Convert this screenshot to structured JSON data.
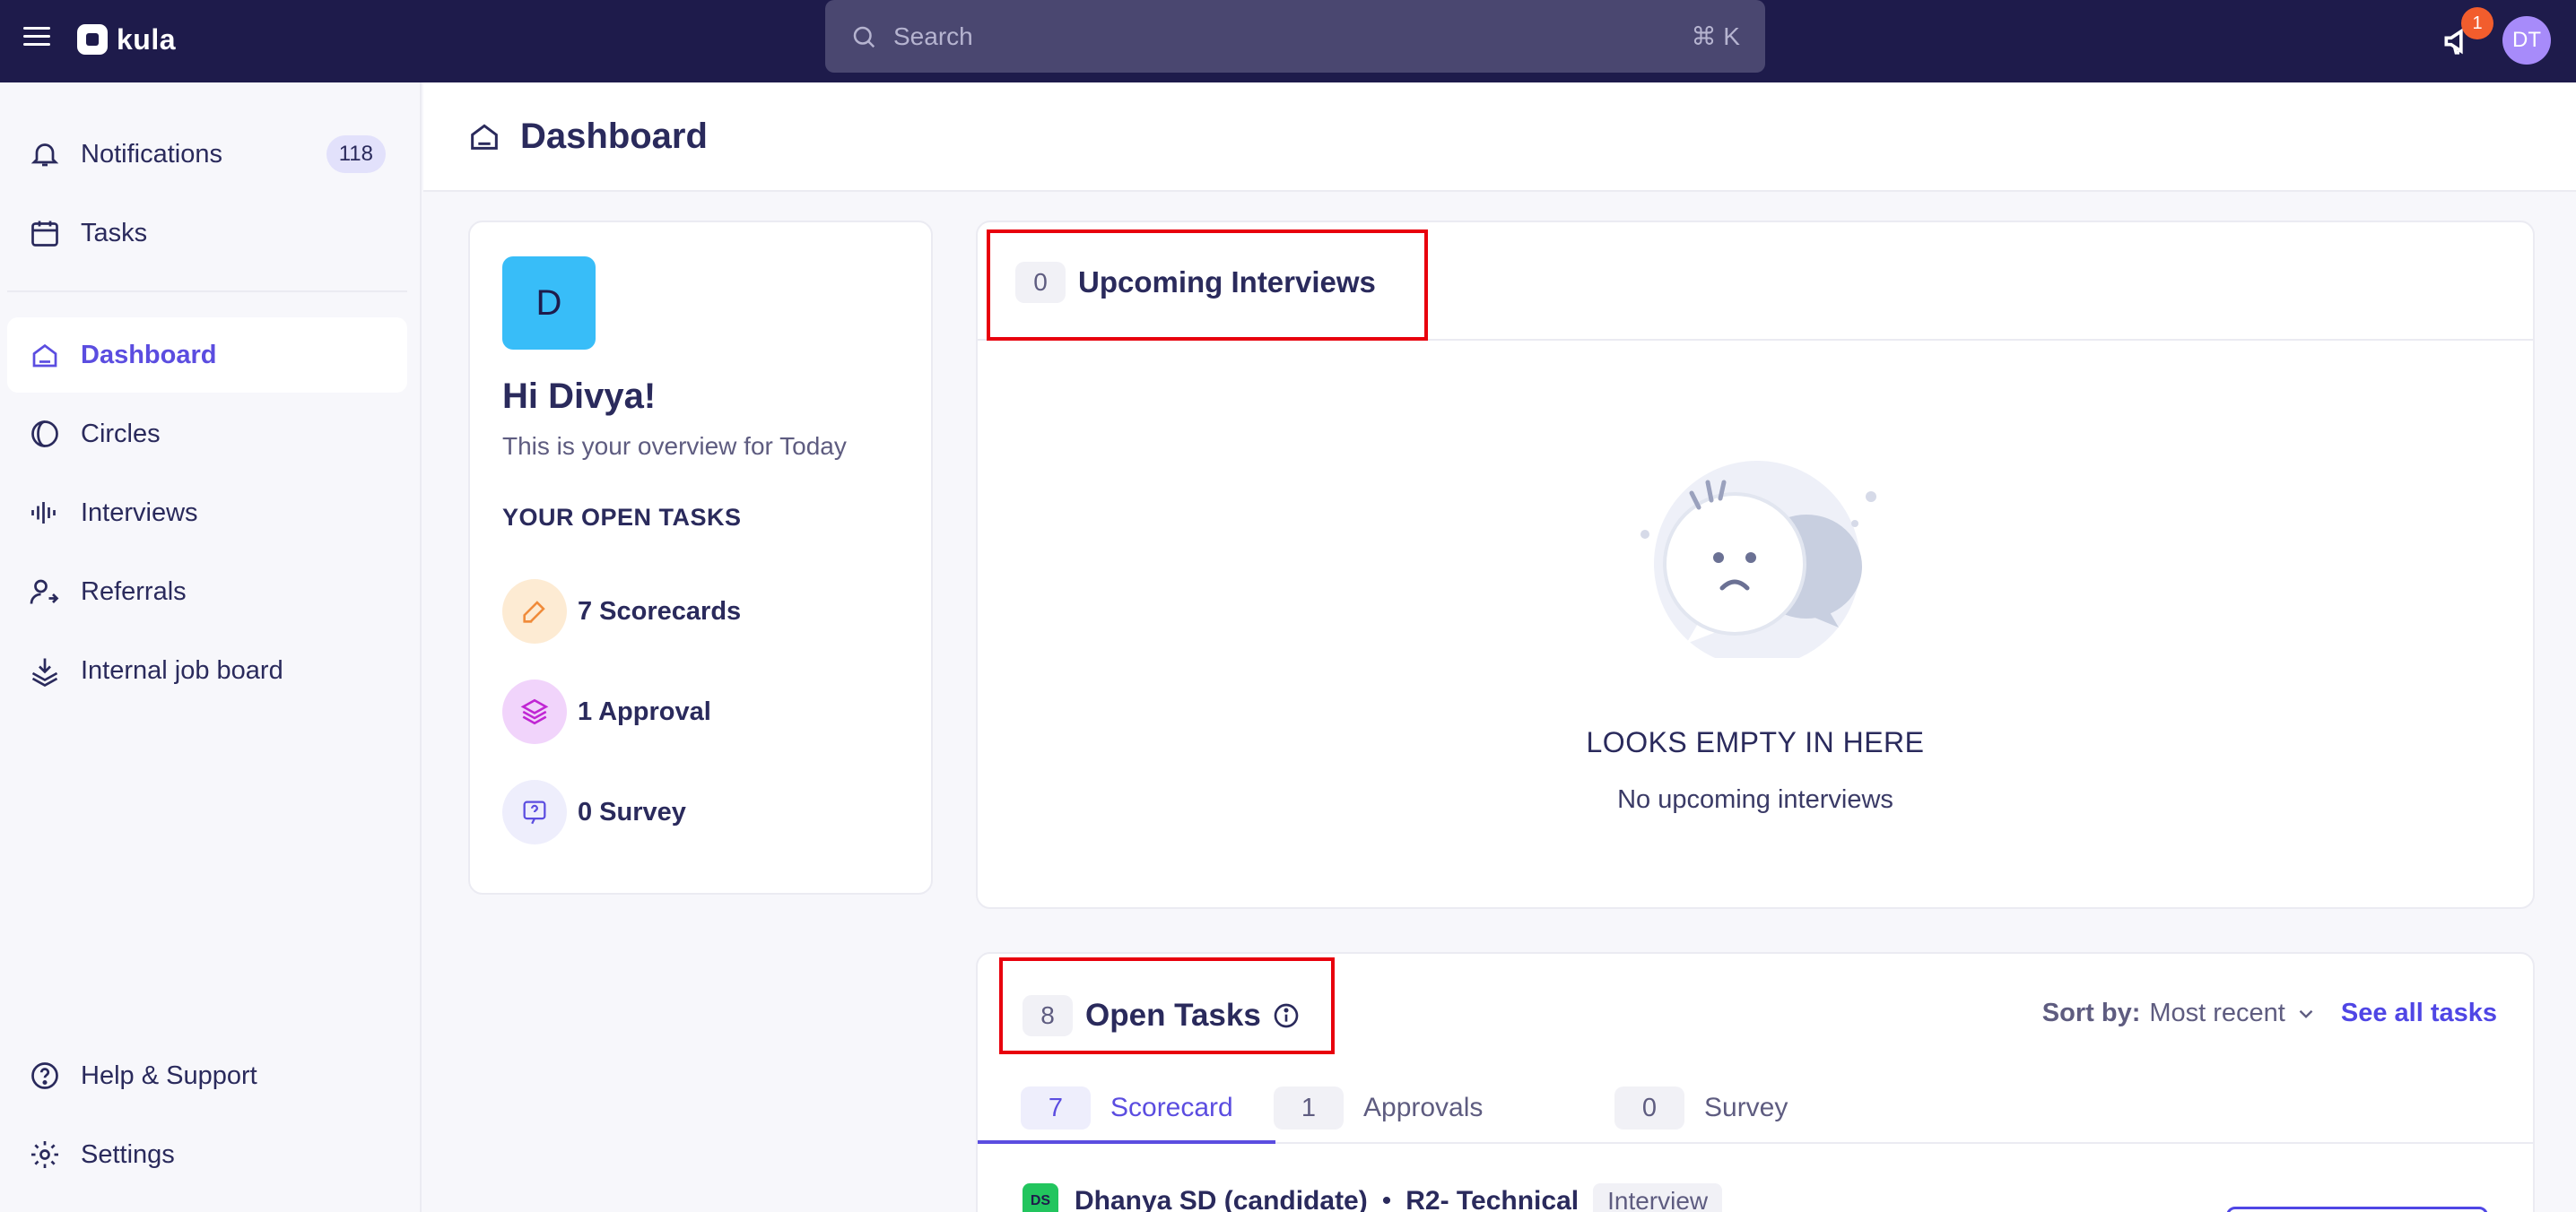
{
  "app": {
    "name": "kula"
  },
  "search": {
    "placeholder": "Search",
    "shortcut": "⌘ K"
  },
  "topbar": {
    "announcement_count": "1",
    "user_initials": "DT"
  },
  "sidebar": {
    "items": [
      {
        "label": "Notifications",
        "icon": "bell-icon",
        "badge": "118"
      },
      {
        "label": "Tasks",
        "icon": "calendar-icon"
      },
      {
        "label": "Dashboard",
        "icon": "home-icon",
        "active": true
      },
      {
        "label": "Circles",
        "icon": "circles-icon"
      },
      {
        "label": "Interviews",
        "icon": "audio-wave-icon"
      },
      {
        "label": "Referrals",
        "icon": "user-arrow-icon"
      },
      {
        "label": "Internal job board",
        "icon": "stack-icon"
      }
    ],
    "footer": [
      {
        "label": "Help & Support",
        "icon": "help-icon"
      },
      {
        "label": "Settings",
        "icon": "gear-icon"
      }
    ]
  },
  "page": {
    "title": "Dashboard"
  },
  "welcome": {
    "avatar_letter": "D",
    "greeting": "Hi Divya!",
    "subtitle": "This is your overview for Today",
    "open_tasks_title": "YOUR OPEN TASKS",
    "tasks": [
      {
        "label": "7 Scorecards",
        "icon": "pencil-icon"
      },
      {
        "label": "1 Approval",
        "icon": "layers-icon"
      },
      {
        "label": "0 Survey",
        "icon": "survey-icon"
      }
    ]
  },
  "interviews": {
    "count": "0",
    "title": "Upcoming Interviews",
    "empty_title": "LOOKS EMPTY IN HERE",
    "empty_subtitle": "No upcoming interviews"
  },
  "open_tasks": {
    "count": "8",
    "title": "Open Tasks",
    "sort_label": "Sort by:",
    "sort_value": "Most recent",
    "see_all": "See all tasks",
    "tabs": [
      {
        "count": "7",
        "label": "Scorecard",
        "active": true
      },
      {
        "count": "1",
        "label": "Approvals"
      },
      {
        "count": "0",
        "label": "Survey"
      }
    ],
    "rows": [
      {
        "avatar": "DS",
        "name": "Dhanya SD (candidate)",
        "separator": "•",
        "stage": "R2- Technical",
        "tag": "Interview"
      }
    ]
  },
  "colors": {
    "topbar": "#1e1b4b",
    "accent": "#5b4de0",
    "highlight": "#e8000d"
  }
}
